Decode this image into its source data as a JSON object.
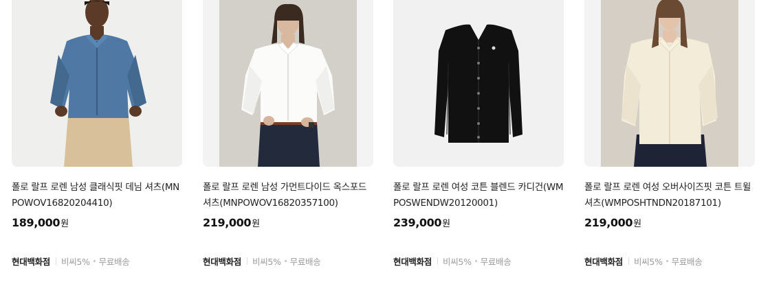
{
  "products": [
    {
      "name": "폴로 랄프 로렌 남성 클래식핏 데님 셔츠(MNPOWOV16820204410)",
      "price": "189,000",
      "currency": "원",
      "store": "현대백화점",
      "card_benefit": "비씨5%",
      "shipping": "무료배송",
      "image": "man-denim-shirt-photo"
    },
    {
      "name": "폴로 랄프 로렌 남성 가먼트다이드 옥스포드 셔츠(MNPOWOV16820357100)",
      "price": "219,000",
      "currency": "원",
      "store": "현대백화점",
      "card_benefit": "비씨5%",
      "shipping": "무료배송",
      "image": "man-white-oxford-shirt-photo"
    },
    {
      "name": "폴로 랄프 로렌 여성 코튼 블렌드 카디건(WMPOSWENDW20120001)",
      "price": "239,000",
      "currency": "원",
      "store": "현대백화점",
      "card_benefit": "비씨5%",
      "shipping": "무료배송",
      "image": "black-cardigan-photo"
    },
    {
      "name": "폴로 랄프 로렌 여성 오버사이즈핏 코튼 트윌 셔츠(WMPOSHTNDN20187101)",
      "price": "219,000",
      "currency": "원",
      "store": "현대백화점",
      "card_benefit": "비씨5%",
      "shipping": "무료배송",
      "image": "woman-cream-shirt-photo"
    }
  ]
}
